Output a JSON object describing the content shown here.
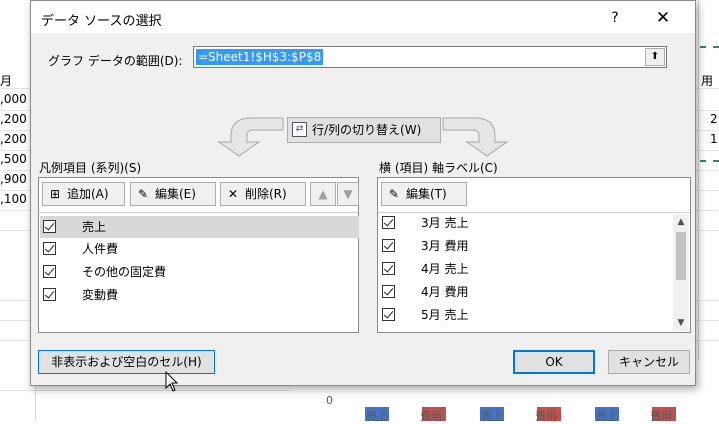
{
  "spreadsheet": {
    "partial_cells_left": [
      "月",
      ",000",
      ",200",
      ",200",
      ",500",
      ",900",
      ",100"
    ],
    "partial_cells_right": [
      "用",
      "2",
      "1"
    ],
    "chart_axis_zero": "0",
    "chart_x_labels": [
      "売上",
      "費用",
      "売上",
      "費用",
      "売上",
      "費用"
    ]
  },
  "dialog": {
    "title": "データ ソースの選択",
    "help_label": "?",
    "close_label": "✕",
    "range_label": "グラフ データの範囲(D):",
    "range_value": "=Sheet1!$H$3:$P$8",
    "collapse_label": "⬆",
    "switch_label": "行/列の切り替え(W)",
    "legend": {
      "title": "凡例項目 (系列)(S)",
      "add_label": "追加(A)",
      "edit_label": "編集(E)",
      "delete_label": "削除(R)",
      "up_label": "▲",
      "down_label": "▼",
      "items": [
        {
          "label": "売上",
          "checked": true,
          "selected": true
        },
        {
          "label": "人件費",
          "checked": true
        },
        {
          "label": "その他の固定費",
          "checked": true
        },
        {
          "label": "変動費",
          "checked": true
        }
      ]
    },
    "axis": {
      "title": "横 (項目) 軸ラベル(C)",
      "edit_label": "編集(T)",
      "items": [
        {
          "label": "3月 売上",
          "checked": true
        },
        {
          "label": "3月 費用",
          "checked": true
        },
        {
          "label": "4月 売上",
          "checked": true
        },
        {
          "label": "4月 費用",
          "checked": true
        },
        {
          "label": "5月 売上",
          "checked": true
        }
      ],
      "scroll_up": "▲",
      "scroll_down": "▼"
    },
    "hidden_cells_label": "非表示および空白のセル(H)",
    "ok_label": "OK",
    "cancel_label": "キャンセル"
  },
  "colors": {
    "accent": "#0078d7",
    "selection": "#3399ff",
    "bar_blue": "#4472c4",
    "bar_red": "#c0504d"
  }
}
